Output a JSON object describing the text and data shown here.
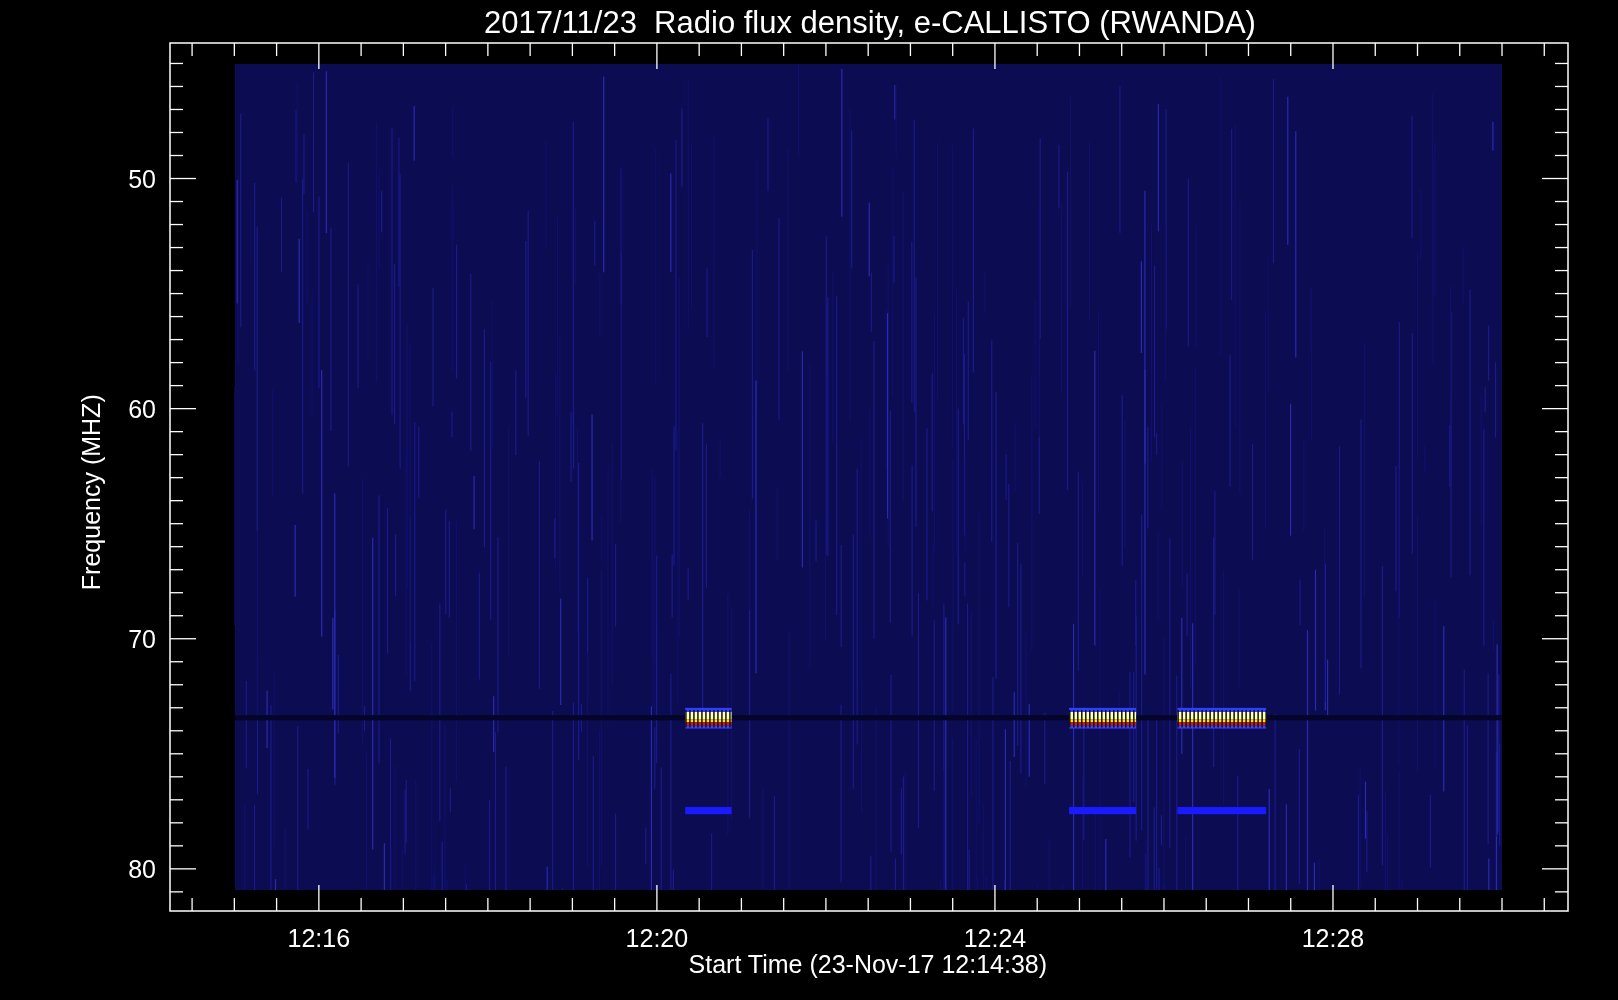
{
  "title": "2017/11/23  Radio flux density, e-CALLISTO (RWANDA)",
  "y_axis": {
    "label": "Frequency (MHZ)",
    "tick_labels": [
      "50",
      "60",
      "70",
      "80"
    ]
  },
  "x_axis": {
    "label": "Start Time (23-Nov-17 12:14:38)",
    "tick_labels": [
      "12:16",
      "12:20",
      "12:24",
      "12:28"
    ]
  }
}
